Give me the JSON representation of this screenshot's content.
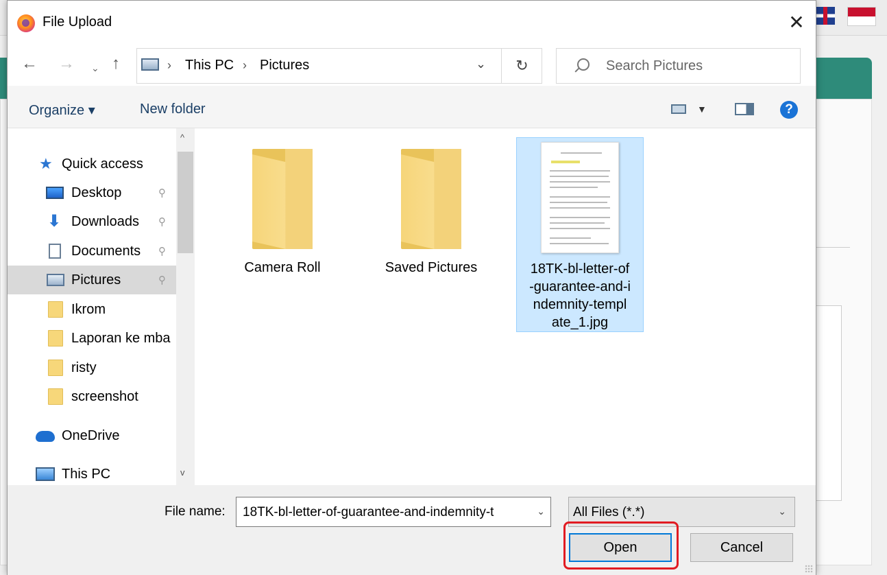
{
  "dialog": {
    "title": "File Upload",
    "close_glyph": "✕"
  },
  "nav": {
    "back_glyph": "←",
    "forward_glyph": "→",
    "recent_glyph": "⌄",
    "up_glyph": "↑",
    "breadcrumb": [
      "This PC",
      "Pictures"
    ],
    "breadcrumb_sep": "›",
    "dropdown_glyph": "⌄",
    "refresh_glyph": "↻",
    "search_placeholder": "Search Pictures"
  },
  "commands": {
    "organize": "Organize ▾",
    "new_folder": "New folder",
    "view_dropdown_glyph": "▼",
    "help_glyph": "?"
  },
  "sidebar": {
    "items": [
      {
        "label": "Quick access",
        "icon": "star-icon"
      },
      {
        "label": "Desktop",
        "icon": "desktop-icon",
        "pinned": true
      },
      {
        "label": "Downloads",
        "icon": "download-icon",
        "pinned": true
      },
      {
        "label": "Documents",
        "icon": "documents-icon",
        "pinned": true
      },
      {
        "label": "Pictures",
        "icon": "pictures-icon",
        "pinned": true,
        "selected": true
      },
      {
        "label": "Ikrom",
        "icon": "folder-icon"
      },
      {
        "label": "Laporan ke mba",
        "icon": "folder-icon"
      },
      {
        "label": "risty",
        "icon": "folder-icon"
      },
      {
        "label": "screenshot",
        "icon": "folder-icon"
      },
      {
        "label": "OneDrive",
        "icon": "onedrive-icon"
      },
      {
        "label": "This PC",
        "icon": "this-pc-icon"
      }
    ],
    "pin_glyph": "📌",
    "scroll_up_glyph": "^",
    "scroll_down_glyph": "v"
  },
  "files": [
    {
      "name": "Camera Roll",
      "type": "folder"
    },
    {
      "name": "Saved Pictures",
      "type": "folder"
    },
    {
      "name_lines": [
        "18TK-bl-letter-of",
        "-guarantee-and-i",
        "ndemnity-templ",
        "ate_1.jpg"
      ],
      "type": "image",
      "selected": true
    }
  ],
  "bottom": {
    "file_name_label": "File name:",
    "file_name_value": "18TK-bl-letter-of-guarantee-and-indemnity-t",
    "filter_value": "All Files (*.*)",
    "dropdown_glyph": "⌄",
    "open_label": "Open",
    "cancel_label": "Cancel"
  },
  "colors": {
    "accent": "#0078d7",
    "selection": "#cce8ff",
    "highlight_ring": "#e11b22",
    "folder": "#f6d57a"
  }
}
